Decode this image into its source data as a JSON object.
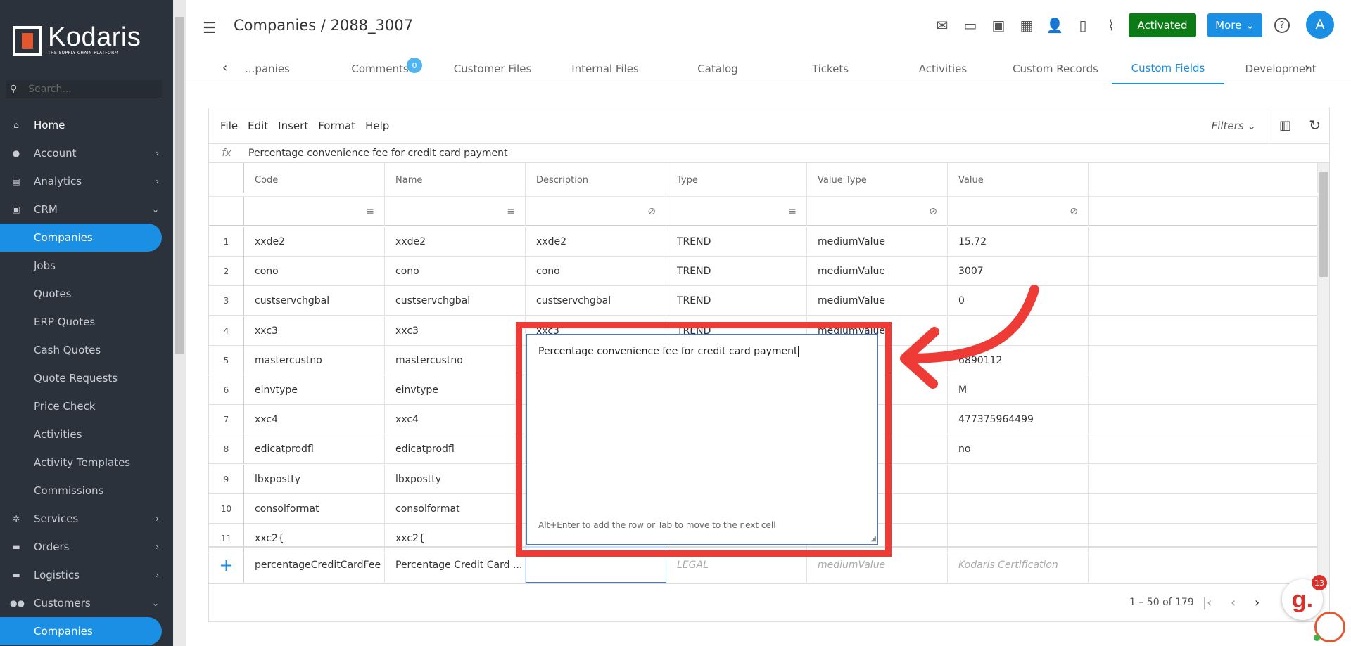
{
  "brand": {
    "name": "Kodaris",
    "tagline": "THE SUPPLY CHAIN PLATFORM"
  },
  "search": {
    "placeholder": "Search..."
  },
  "nav": [
    {
      "label": "Home",
      "icon": "home-icon",
      "type": "top",
      "chevron": ""
    },
    {
      "label": "Account",
      "icon": "account-icon",
      "type": "top",
      "chevron": "›"
    },
    {
      "label": "Analytics",
      "icon": "analytics-icon",
      "type": "top",
      "chevron": "›"
    },
    {
      "label": "CRM",
      "icon": "crm-icon",
      "type": "top",
      "chevron": "⌄"
    },
    {
      "label": "Companies",
      "icon": "",
      "type": "sub-active",
      "chevron": ""
    },
    {
      "label": "Jobs",
      "icon": "",
      "type": "sub",
      "chevron": ""
    },
    {
      "label": "Quotes",
      "icon": "",
      "type": "sub",
      "chevron": ""
    },
    {
      "label": "ERP Quotes",
      "icon": "",
      "type": "sub",
      "chevron": ""
    },
    {
      "label": "Cash Quotes",
      "icon": "",
      "type": "sub",
      "chevron": ""
    },
    {
      "label": "Quote Requests",
      "icon": "",
      "type": "sub",
      "chevron": ""
    },
    {
      "label": "Price Check",
      "icon": "",
      "type": "sub",
      "chevron": ""
    },
    {
      "label": "Activities",
      "icon": "",
      "type": "sub",
      "chevron": ""
    },
    {
      "label": "Activity Templates",
      "icon": "",
      "type": "sub",
      "chevron": ""
    },
    {
      "label": "Commissions",
      "icon": "",
      "type": "sub",
      "chevron": ""
    },
    {
      "label": "Services",
      "icon": "services-icon",
      "type": "top",
      "chevron": "›"
    },
    {
      "label": "Orders",
      "icon": "orders-icon",
      "type": "top",
      "chevron": "›"
    },
    {
      "label": "Logistics",
      "icon": "logistics-icon",
      "type": "top",
      "chevron": "›"
    },
    {
      "label": "Customers",
      "icon": "customers-icon",
      "type": "top",
      "chevron": "⌄"
    },
    {
      "label": "Companies",
      "icon": "",
      "type": "sub-active",
      "chevron": ""
    }
  ],
  "header": {
    "title": "Companies / 2088_3007",
    "activated_label": "Activated",
    "more_label": "More",
    "avatar_initial": "A",
    "help": "?"
  },
  "tabs": [
    {
      "label": "...panies",
      "active": false
    },
    {
      "label": "Comments",
      "active": false
    },
    {
      "label": "Customer Files",
      "active": false
    },
    {
      "label": "Internal Files",
      "active": false
    },
    {
      "label": "Catalog",
      "active": false
    },
    {
      "label": "Tickets",
      "active": false
    },
    {
      "label": "Activities",
      "active": false
    },
    {
      "label": "Custom Records",
      "active": false
    },
    {
      "label": "Custom Fields",
      "active": true
    },
    {
      "label": "Development",
      "active": false
    }
  ],
  "comments_badge": "0",
  "menubar": [
    "File",
    "Edit",
    "Insert",
    "Format",
    "Help"
  ],
  "filters_label": "Filters",
  "formula": {
    "fx": "fx",
    "value": "Percentage convenience fee for credit card payment"
  },
  "columns": [
    "Code",
    "Name",
    "Description",
    "Type",
    "Value Type",
    "Value"
  ],
  "rows": [
    {
      "n": "1",
      "code": "xxde2",
      "name": "xxde2",
      "desc": "xxde2",
      "type": "TREND",
      "vtype": "mediumValue",
      "value": "15.72"
    },
    {
      "n": "2",
      "code": "cono",
      "name": "cono",
      "desc": "cono",
      "type": "TREND",
      "vtype": "mediumValue",
      "value": "3007"
    },
    {
      "n": "3",
      "code": "custservchgbal",
      "name": "custservchgbal",
      "desc": "custservchgbal",
      "type": "TREND",
      "vtype": "mediumValue",
      "value": "0"
    },
    {
      "n": "4",
      "code": "xxc3",
      "name": "xxc3",
      "desc": "xxc3",
      "type": "TREND",
      "vtype": "mediumValue",
      "value": ""
    },
    {
      "n": "5",
      "code": "mastercustno",
      "name": "mastercustno",
      "desc": "",
      "type": "",
      "vtype": "",
      "value": "6890112"
    },
    {
      "n": "6",
      "code": "einvtype",
      "name": "einvtype",
      "desc": "",
      "type": "",
      "vtype": "",
      "value": "M"
    },
    {
      "n": "7",
      "code": "xxc4",
      "name": "xxc4",
      "desc": "",
      "type": "",
      "vtype": "",
      "value": "477375964499"
    },
    {
      "n": "8",
      "code": "edicatprodfl",
      "name": "edicatprodfl",
      "desc": "",
      "type": "",
      "vtype": "",
      "value": "no"
    },
    {
      "n": "9",
      "code": "lbxpostty",
      "name": "lbxpostty",
      "desc": "",
      "type": "",
      "vtype": "",
      "value": ""
    },
    {
      "n": "10",
      "code": "consolformat",
      "name": "consolformat",
      "desc": "",
      "type": "",
      "vtype": "",
      "value": ""
    },
    {
      "n": "11",
      "code": "xxc2{",
      "name": "xxc2{",
      "desc": "",
      "type": "",
      "vtype": "",
      "value": ""
    }
  ],
  "new_row": {
    "plus": "+",
    "code": "percentageCreditCardFee",
    "name": "Percentage Credit Card ...",
    "desc": "",
    "type_ph": "LEGAL",
    "vtype_ph": "mediumValue",
    "value_ph": "Kodaris Certification"
  },
  "editor": {
    "text": "Percentage convenience fee for credit card payment",
    "hint": "Alt+Enter to add the row or Tab to move to the next cell"
  },
  "pager": {
    "range": "1 – 50 of 179"
  },
  "chat": {
    "letter": "g.",
    "count": "13"
  },
  "colors": {
    "accent": "#1a8fe3",
    "activated": "#0c7a15",
    "annotation": "#ee3b36",
    "sidebar": "#2b323b"
  }
}
